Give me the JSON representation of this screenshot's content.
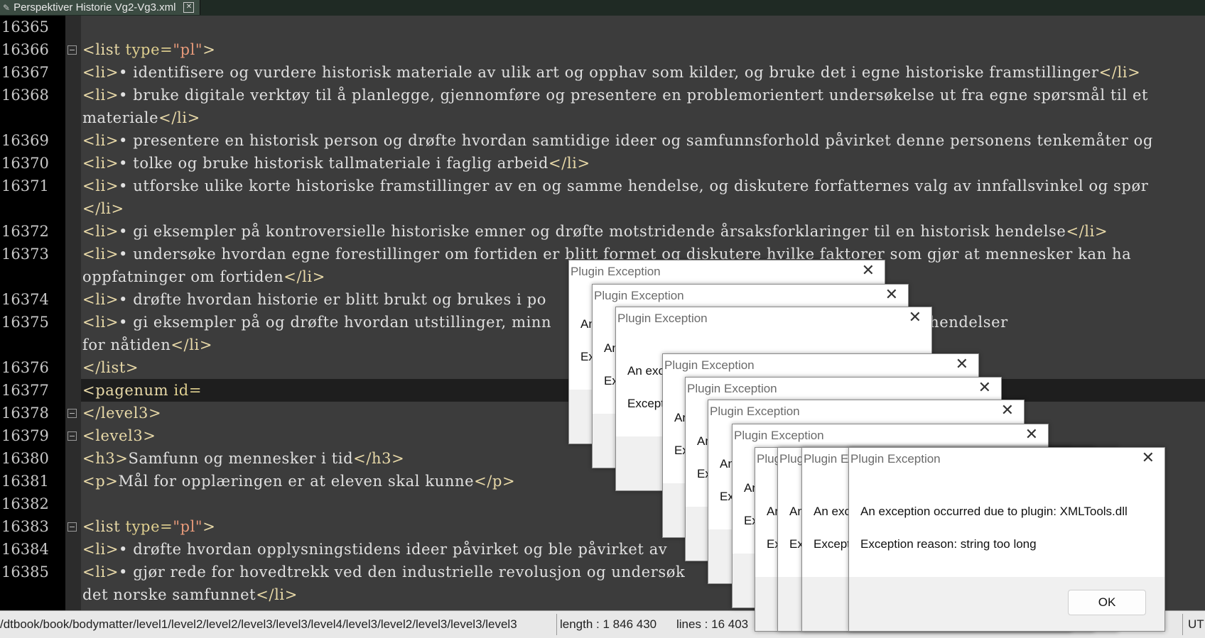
{
  "tab": {
    "title": "Perspektiver Historie Vg2-Vg3.xml"
  },
  "lines": [
    {
      "num": "16365",
      "html": ""
    },
    {
      "num": "16366",
      "html": "<span class='tag'>&lt;list</span> <span class='attr'>type=</span><span class='val'>\"pl\"</span><span class='tag'>&gt;</span>"
    },
    {
      "num": "16367",
      "html": "<span class='tag'>&lt;li&gt;</span>• identifisere og vurdere historisk materiale av ulik art og opphav som kilder, og bruke det i egne historiske framstillinger<span class='tag'>&lt;/li&gt;</span>"
    },
    {
      "num": "16368",
      "html": "<span class='tag'>&lt;li&gt;</span>• bruke digitale verktøy til å planlegge, gjennomføre og presentere en problemorientert undersøkelse ut fra egne spørsmål til et"
    },
    {
      "num": "",
      "html": "materiale<span class='tag'>&lt;/li&gt;</span>"
    },
    {
      "num": "16369",
      "html": "<span class='tag'>&lt;li&gt;</span>• presentere en historisk person og drøfte hvordan samtidige ideer og samfunnsforhold påvirket denne personens tenkemåter og"
    },
    {
      "num": "16370",
      "html": "<span class='tag'>&lt;li&gt;</span>• tolke og bruke historisk tallmateriale i faglig arbeid<span class='tag'>&lt;/li&gt;</span>"
    },
    {
      "num": "16371",
      "html": "<span class='tag'>&lt;li&gt;</span>• utforske ulike korte historiske framstillinger av en og samme hendelse, og diskutere forfatternes valg av innfallsvinkel og spør"
    },
    {
      "num": "",
      "html": "<span class='tag'>&lt;/li&gt;</span>"
    },
    {
      "num": "16372",
      "html": "<span class='tag'>&lt;li&gt;</span>• gi eksempler på kontroversielle historiske emner og drøfte motstridende årsaksforklaringer til en historisk hendelse<span class='tag'>&lt;/li&gt;</span>"
    },
    {
      "num": "16373",
      "html": "<span class='tag'>&lt;li&gt;</span>• undersøke hvordan egne forestillinger om fortiden er blitt formet og diskutere hvilke faktorer som gjør at mennesker kan ha"
    },
    {
      "num": "",
      "html": "oppfatninger om fortiden<span class='tag'>&lt;/li&gt;</span>"
    },
    {
      "num": "16374",
      "html": "<span class='tag'>&lt;li&gt;</span>• drøfte hvordan historie er blitt brukt og brukes i po"
    },
    {
      "num": "16375",
      "html": "<span class='tag'>&lt;li&gt;</span>• gi eksempler på og drøfte hvordan utstillinger, minn                                       v bestemte historiske hendelser"
    },
    {
      "num": "",
      "html": "for nåtiden<span class='tag'>&lt;/li&gt;</span>"
    },
    {
      "num": "16376",
      "html": "<span class='tag'>&lt;/list&gt;</span>"
    },
    {
      "num": "16377",
      "html": "<span class='tag'>&lt;pagenum</span> <span class='attr'>id=</span>"
    },
    {
      "num": "16378",
      "html": "<span class='tag'>&lt;/level3&gt;</span>"
    },
    {
      "num": "16379",
      "html": "<span class='tag'>&lt;level3&gt;</span>"
    },
    {
      "num": "16380",
      "html": "<span class='tag'>&lt;h3&gt;</span>Samfunn og mennesker i tid<span class='tag'>&lt;/h3&gt;</span>"
    },
    {
      "num": "16381",
      "html": "<span class='tag'>&lt;p&gt;</span>Mål for opplæringen er at eleven skal kunne<span class='tag'>&lt;/p&gt;</span>"
    },
    {
      "num": "16382",
      "html": ""
    },
    {
      "num": "16383",
      "html": "<span class='tag'>&lt;list</span> <span class='attr'>type=</span><span class='val'>\"pl\"</span><span class='tag'>&gt;</span>"
    },
    {
      "num": "16384",
      "html": "<span class='tag'>&lt;li&gt;</span>• drøfte hvordan opplysningstidens ideer påvirket og ble påvirket av"
    },
    {
      "num": "16385",
      "html": "<span class='tag'>&lt;li&gt;</span>• gjør rede for hovedtrekk ved den industrielle revolusjon og undersøk                                        g sosi"
    },
    {
      "num": "",
      "html": "det norske samfunnet<span class='tag'>&lt;/li&gt;</span>"
    }
  ],
  "status": {
    "path": "/dtbook/book/bodymatter/level1/level2/level2/level3/level3/level4/level3/level2/level3/level3/level3",
    "length": "length : 1 846 430",
    "lines": "lines : 16 403",
    "encoding": "UTF"
  },
  "dialog": {
    "title": "Plugin Exception",
    "close": "✕",
    "message": "An exception occurred due to plugin: XMLTools.dll",
    "reason": "Exception reason: string too long",
    "ok": "OK"
  }
}
